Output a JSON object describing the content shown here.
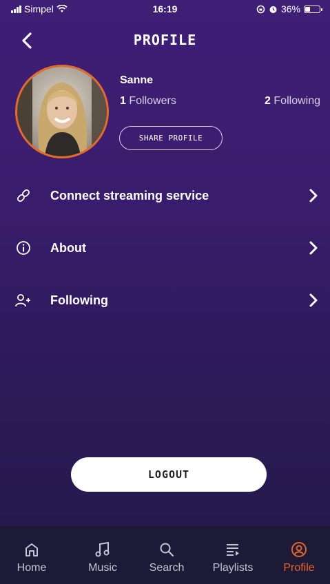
{
  "status": {
    "carrier": "Simpel",
    "time": "16:19",
    "battery": "36%",
    "battery_level": 0.36
  },
  "header": {
    "title": "PROFILE"
  },
  "profile": {
    "name": "Sanne",
    "followers_count": "1",
    "followers_label": "Followers",
    "following_count": "2",
    "following_label": "Following",
    "share_label": "SHARE PROFILE"
  },
  "menu": [
    {
      "label": "Connect streaming service",
      "icon": "link-icon"
    },
    {
      "label": "About",
      "icon": "info-icon"
    },
    {
      "label": "Following",
      "icon": "add-person-icon"
    }
  ],
  "logout_label": "LOGOUT",
  "tabs": [
    {
      "label": "Home",
      "icon": "home-icon"
    },
    {
      "label": "Music",
      "icon": "music-note-icon"
    },
    {
      "label": "Search",
      "icon": "search-icon"
    },
    {
      "label": "Playlists",
      "icon": "playlist-icon"
    },
    {
      "label": "Profile",
      "icon": "profile-icon",
      "active": true
    }
  ],
  "colors": {
    "accent": "#e8642a",
    "background": "#3f1f76",
    "tabbar": "#1c1a36"
  }
}
